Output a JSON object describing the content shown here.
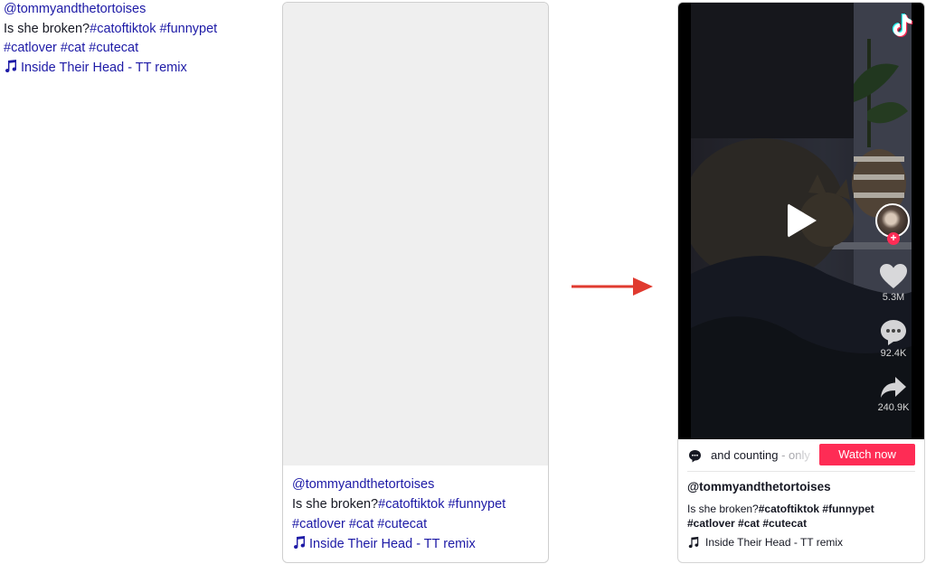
{
  "raw_embed": {
    "username": "@tommyandthetortoises",
    "caption_prefix": "Is she broken?",
    "tags_line1": "#catoftiktok #funnypet",
    "tags_line2": "#catlover #cat #cutecat",
    "music": "Inside Their Head - TT remix",
    "music_icon": "music-note-icon"
  },
  "loading_card": {
    "username": "@tommyandthetortoises",
    "caption_prefix": "Is she broken?",
    "tags_line1": "#catoftiktok #funnypet",
    "tags_line2": "#catlover #cat #cutecat",
    "music": "Inside Their Head - TT remix"
  },
  "arrow_color": "#e03a2f",
  "tiktok_embed": {
    "logo": "tiktok-logo",
    "likes": "5.3M",
    "comments": "92.4K",
    "shares": "240.9K",
    "promo_text": "and counting",
    "promo_faded": " - only",
    "watch_button": "Watch now",
    "username": "@tommyandthetortoises",
    "caption_prefix": "Is she broken?",
    "tags_line1": "#catoftiktok #funnypet",
    "tags_line2": "#catlover #cat #cutecat",
    "music": "Inside Their Head - TT remix",
    "accent_color": "#fe2c55"
  }
}
